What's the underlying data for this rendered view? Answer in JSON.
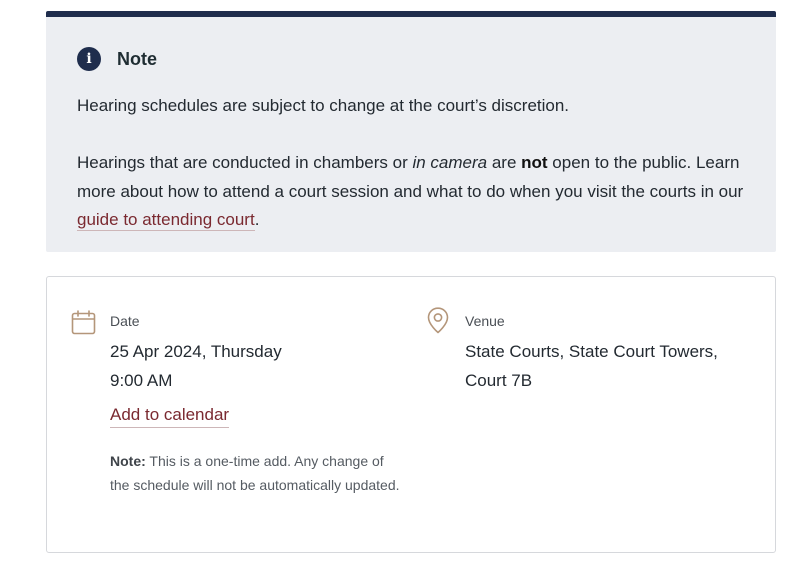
{
  "note": {
    "icon": "info-icon",
    "title": "Note",
    "paragraph1": "Hearing schedules are subject to change at the court’s discretion.",
    "p2_part1": "Hearings that are conducted in chambers or ",
    "p2_italic": "in camera",
    "p2_part2": " are ",
    "p2_bold": "not",
    "p2_part3": " open to the public. Learn more about how to attend a court session and what to do when you visit the courts in our ",
    "link_text": "guide to attending court",
    "p2_end": "."
  },
  "details": {
    "date": {
      "icon": "calendar-icon",
      "label": "Date",
      "value_line1": "25 Apr 2024, Thursday",
      "value_line2": "9:00 AM",
      "add_calendar": "Add to calendar",
      "note_label": "Note:",
      "note_text": " This is a one-time add. Any change of the schedule will not be automatically updated."
    },
    "venue": {
      "icon": "map-pin-icon",
      "label": "Venue",
      "value_line1": "State Courts, State Court Towers,",
      "value_line2": "Court 7B"
    }
  },
  "colors": {
    "accent_navy": "#1f2d4d",
    "link_maroon": "#7a2930",
    "icon_tan": "#b4967a",
    "note_bg": "#eceef2"
  }
}
